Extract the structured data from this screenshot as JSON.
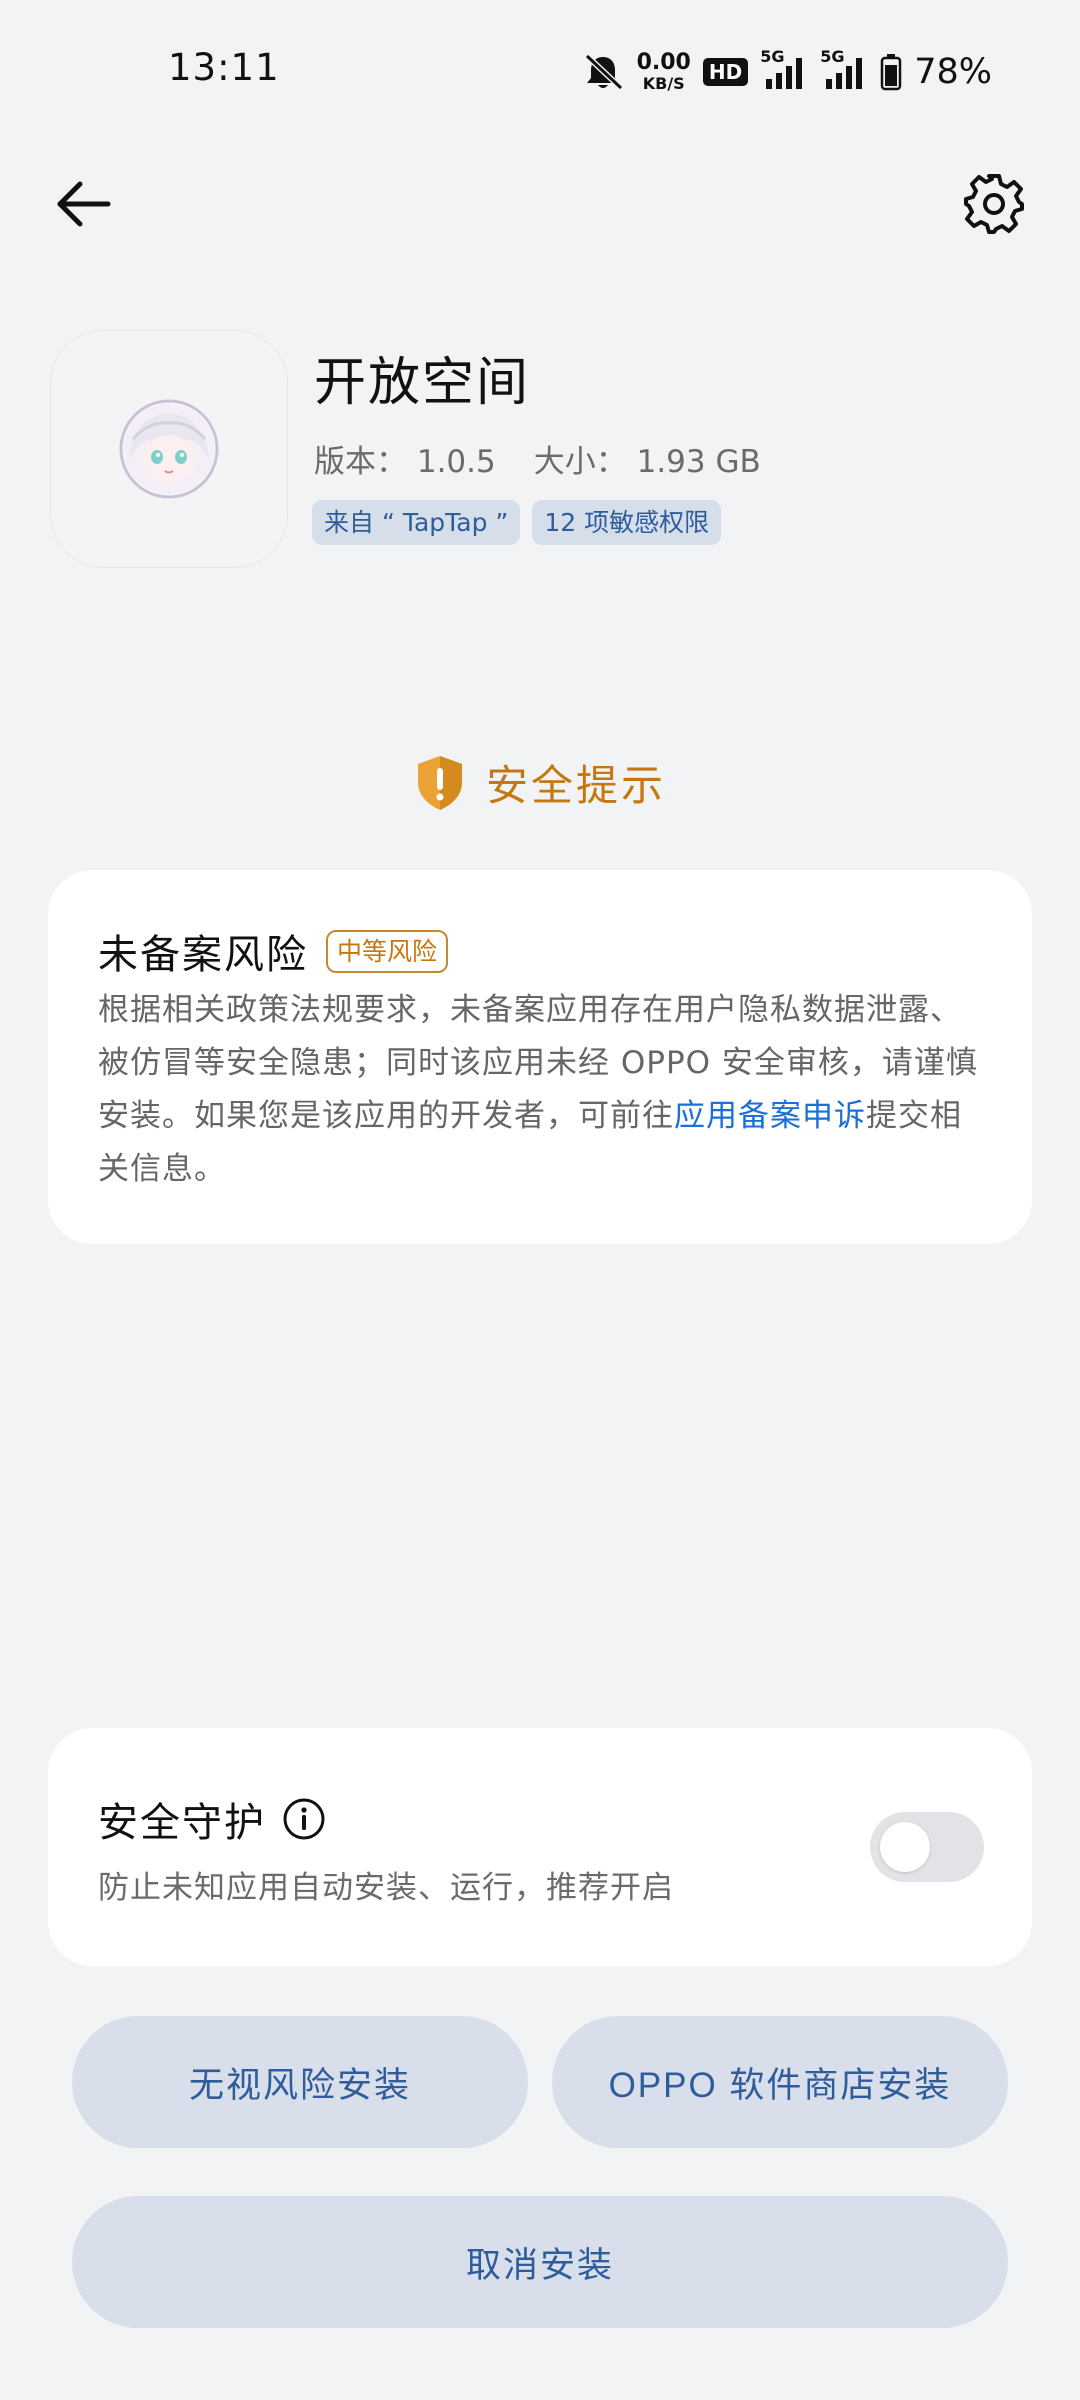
{
  "status_bar": {
    "time": "13:11",
    "speed_value": "0.00",
    "speed_unit": "KB/S",
    "hd_label": "HD",
    "network_1": "5G",
    "network_2": "5G",
    "battery": "78%",
    "icons": [
      "mute-bell-icon",
      "hd-icon",
      "signal-icon",
      "battery-icon"
    ]
  },
  "header": {
    "back_icon": "arrow-left-icon",
    "settings_icon": "gear-icon"
  },
  "app": {
    "name": "开放空间",
    "version_label": "版本：",
    "version": "1.0.5",
    "size_label": "大小：",
    "size": "1.93 GB",
    "tags": [
      "来自 “ TapTap ”",
      "12 项敏感权限"
    ],
    "icon": "anime-character-avatar"
  },
  "safety": {
    "title": "安全提示",
    "icon": "shield-warning-icon",
    "accent_color": "#c4780f"
  },
  "risk": {
    "title": "未备案风险",
    "badge": "中等风险",
    "text_before": "根据相关政策法规要求，未备案应用存在用户隐私数据泄露、被仿冒等安全隐患；同时该应用未经 OPPO 安全审核，请谨慎安装。如果您是该应用的开发者，可前往",
    "link": "应用备案申诉",
    "text_after": "提交相关信息。",
    "link_color": "#1a6fd8"
  },
  "protection": {
    "title": "安全守护",
    "info_icon": "info-circle-icon",
    "subtitle": "防止未知应用自动安装、运行，推荐开启",
    "enabled": false
  },
  "buttons": {
    "ignore_risk": "无视风险安装",
    "store_install": "OPPO  软件商店安装",
    "cancel": "取消安装"
  }
}
